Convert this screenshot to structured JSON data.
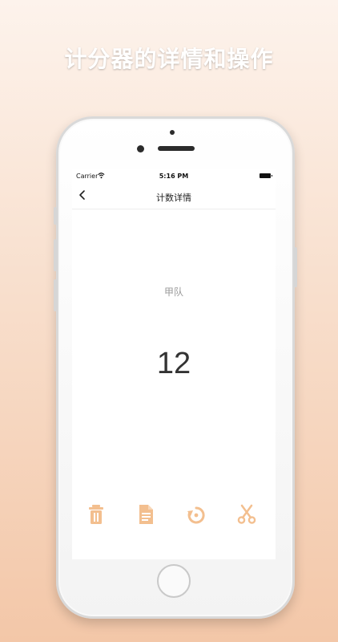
{
  "promo": {
    "title": "计分器的详情和操作"
  },
  "status_bar": {
    "carrier": "Carrier",
    "time": "5:16 PM"
  },
  "nav": {
    "title": "计数详情",
    "back_icon": "chevron-left-icon"
  },
  "counter": {
    "team_name": "甲队",
    "count": "12"
  },
  "toolbar": {
    "accent_color": "#f3bf8f",
    "buttons": [
      {
        "name": "delete",
        "icon": "trash-icon"
      },
      {
        "name": "notes",
        "icon": "document-icon"
      },
      {
        "name": "reset",
        "icon": "reset-icon"
      },
      {
        "name": "split",
        "icon": "scissors-icon"
      }
    ]
  }
}
